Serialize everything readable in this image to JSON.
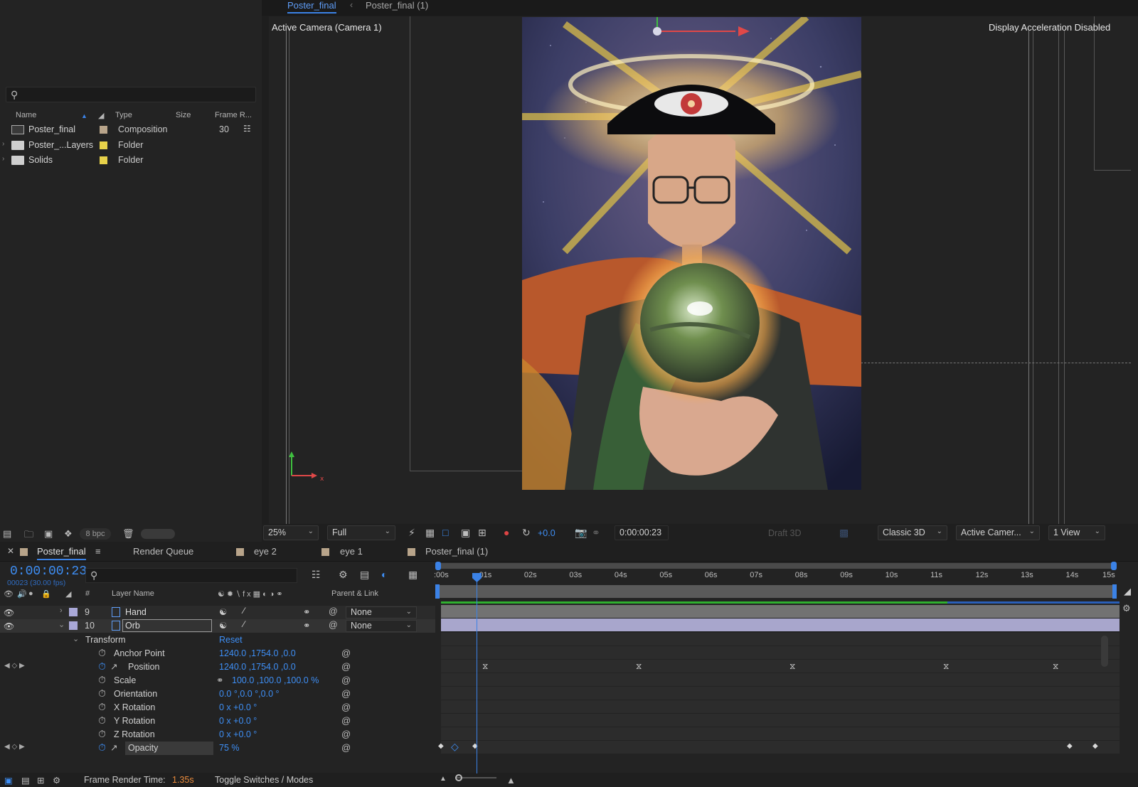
{
  "project": {
    "columns": {
      "name": "Name",
      "type": "Type",
      "size": "Size",
      "frame_rate": "Frame R..."
    },
    "items": [
      {
        "name": "Poster_final",
        "type": "Composition",
        "frame_rate": "30",
        "label_color": "#b8a48a"
      },
      {
        "name": "Poster_...Layers",
        "type": "Folder",
        "frame_rate": "",
        "label_color": "#e8d24a"
      },
      {
        "name": "Solids",
        "type": "Folder",
        "frame_rate": "",
        "label_color": "#e8d24a"
      }
    ],
    "bpc": "8 bpc"
  },
  "viewer": {
    "tabs": {
      "active": "Poster_final",
      "separator": "‹",
      "other": "Poster_final (1)"
    },
    "camera_label": "Active Camera (Camera 1)",
    "accel_label": "Display Acceleration Disabled",
    "toolbar": {
      "zoom": "25%",
      "resolution": "Full",
      "exposure": "+0.0",
      "timecode": "0:00:00:23",
      "draft3d": "Draft 3D",
      "renderer": "Classic 3D",
      "view": "Active Camer...",
      "layout": "1 View"
    }
  },
  "timeline": {
    "tabs": {
      "comp": "Poster_final",
      "render_queue": "Render Queue",
      "eye2": "eye 2",
      "eye1": "eye 1",
      "comp2": "Poster_final (1)"
    },
    "timecode": "0:00:00:23",
    "fps_line": "00023 (30.00 fps)",
    "columns": {
      "number": "#",
      "layer_name": "Layer Name",
      "parent": "Parent & Link"
    },
    "ruler_ticks": [
      ":00s",
      "01s",
      "02s",
      "03s",
      "04s",
      "05s",
      "06s",
      "07s",
      "08s",
      "09s",
      "10s",
      "11s",
      "12s",
      "13s",
      "14s",
      "15s"
    ],
    "layers": [
      {
        "num": "9",
        "name": "Hand",
        "parent": "None"
      },
      {
        "num": "10",
        "name": "Orb",
        "parent": "None"
      }
    ],
    "transform": {
      "group": "Transform",
      "reset": "Reset",
      "props": [
        {
          "name": "Anchor Point",
          "value": "1240.0 ,1754.0 ,0.0"
        },
        {
          "name": "Position",
          "value": "1240.0 ,1754.0 ,0.0"
        },
        {
          "name": "Scale",
          "value": "100.0 ,100.0 ,100.0 %"
        },
        {
          "name": "Orientation",
          "value": "0.0 °,0.0 °,0.0 °"
        },
        {
          "name": "X Rotation",
          "value": "0 x +0.0 °"
        },
        {
          "name": "Y Rotation",
          "value": "0 x +0.0 °"
        },
        {
          "name": "Z Rotation",
          "value": "0 x +0.0 °"
        },
        {
          "name": "Opacity",
          "value": "75 %"
        }
      ]
    },
    "footer": {
      "render_label": "Frame Render Time:",
      "render_value": "1.35s",
      "toggle": "Toggle Switches / Modes"
    }
  },
  "colors": {
    "accent": "#3b82e6",
    "timecode": "#3e8ff6",
    "render_time": "#e88a3c"
  }
}
